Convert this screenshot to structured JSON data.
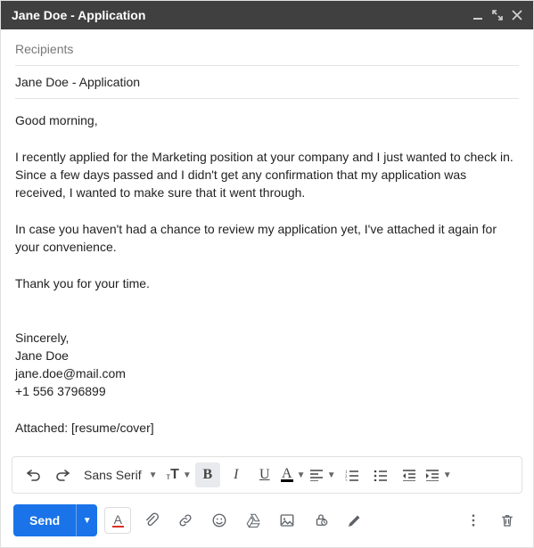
{
  "window": {
    "title": "Jane Doe - Application"
  },
  "fields": {
    "recipients_placeholder": "Recipients",
    "recipients_value": "",
    "subject": "Jane Doe - Application"
  },
  "body": "Good morning,\n\nI recently applied for the Marketing position at your company and I just wanted to check in. Since a few days passed and I didn't get any confirmation that my application was received, I wanted to make sure that it went through.\n\nIn case you haven't had a chance to review my application yet, I've attached it again for your convenience.\n\nThank you for your time.\n\n\nSincerely,\nJane Doe\njane.doe@mail.com\n+1 556 3796899\n\nAttached: [resume/cover]",
  "format_toolbar": {
    "font_family": "Sans Serif",
    "font_size_label": "T",
    "bold": "B",
    "italic": "I",
    "underline": "U",
    "text_color": "A"
  },
  "actions": {
    "send": "Send"
  },
  "icons": {
    "format_text": "A",
    "attach": "attach",
    "link": "link",
    "emoji": "emoji",
    "drive": "drive",
    "image": "image",
    "lock": "lock",
    "pen": "pen",
    "more": "more",
    "trash": "trash"
  }
}
